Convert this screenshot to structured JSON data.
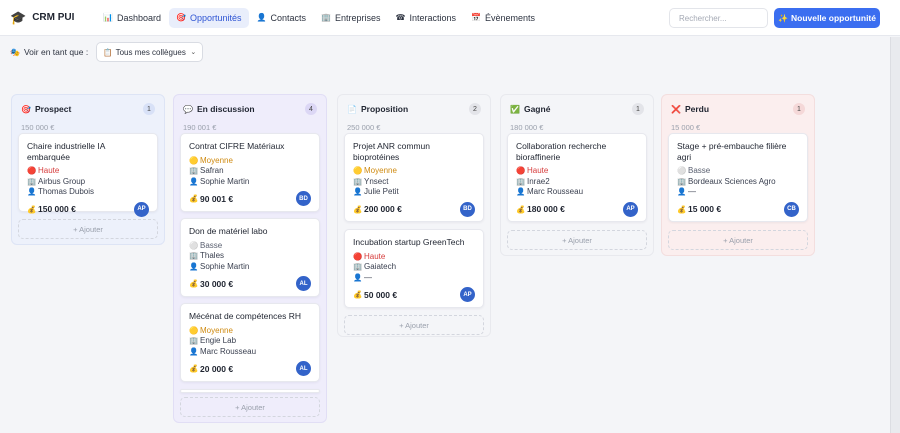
{
  "header": {
    "brand_icon": "🎓",
    "brand_name": "CRM PUI",
    "nav": [
      {
        "icon": "📊",
        "label": "Dashboard",
        "active": false
      },
      {
        "icon": "🎯",
        "label": "Opportunités",
        "active": true
      },
      {
        "icon": "👤",
        "label": "Contacts",
        "active": false
      },
      {
        "icon": "🏢",
        "label": "Entreprises",
        "active": false
      },
      {
        "icon": "☎",
        "label": "Interactions",
        "active": false
      },
      {
        "icon": "📅",
        "label": "Évènements",
        "active": false
      }
    ],
    "search_placeholder": "Rechercher...",
    "new_button_icon": "✨",
    "new_button_label": "Nouvelle opportunité"
  },
  "filter": {
    "icon": "🎭",
    "label": "Voir en tant que :",
    "select_icon": "📋",
    "select_value": "Tous mes collègues",
    "chevron": "⌄"
  },
  "add_label": "+ Ajouter",
  "colors": {
    "accent": "#3b6ef0",
    "haute": "#d63b3b",
    "moyenne": "#cf8a10"
  },
  "columns": [
    {
      "icon": "🎯",
      "title": "Prospect",
      "count": "1",
      "total": "150 000 €",
      "cards": [
        {
          "title": "Chaire industrielle IA embarquée",
          "prio_icon": "🔴",
          "prio": "Haute",
          "prio_class": "haute",
          "company": "Airbus Group",
          "contact": "Thomas Dubois",
          "amount": "150 000 €",
          "avatar": "AP"
        }
      ]
    },
    {
      "icon": "💬",
      "title": "En discussion",
      "count": "4",
      "total": "190 001 €",
      "cards": [
        {
          "title": "Contrat CIFRE Matériaux",
          "prio_icon": "🟡",
          "prio": "Moyenne",
          "prio_class": "moyenne",
          "company": "Safran",
          "contact": "Sophie Martin",
          "amount": "90 001 €",
          "avatar": "BD"
        },
        {
          "title": "Don de matériel labo",
          "prio_icon": "⚪",
          "prio": "Basse",
          "prio_class": "basse",
          "company": "Thales",
          "contact": "Sophie Martin",
          "amount": "30 000 €",
          "avatar": "AL"
        },
        {
          "title": "Mécénat de compétences RH",
          "prio_icon": "🟡",
          "prio": "Moyenne",
          "prio_class": "moyenne",
          "company": "Engie Lab",
          "contact": "Marc Rousseau",
          "amount": "20 000 €",
          "avatar": "AL"
        }
      ]
    },
    {
      "icon": "📄",
      "title": "Proposition",
      "count": "2",
      "total": "250 000 €",
      "cards": [
        {
          "title": "Projet ANR commun bioprotéines",
          "prio_icon": "🟡",
          "prio": "Moyenne",
          "prio_class": "moyenne",
          "company": "Ynsect",
          "contact": "Julie Petit",
          "amount": "200 000 €",
          "avatar": "BD"
        },
        {
          "title": "Incubation startup GreenTech",
          "prio_icon": "🔴",
          "prio": "Haute",
          "prio_class": "haute",
          "company": "Gaiatech",
          "contact": "—",
          "amount": "50 000 €",
          "avatar": "AP"
        }
      ]
    },
    {
      "icon": "✅",
      "title": "Gagné",
      "count": "1",
      "total": "180 000 €",
      "cards": [
        {
          "title": "Collaboration recherche bioraffinerie",
          "prio_icon": "🔴",
          "prio": "Haute",
          "prio_class": "haute",
          "company": "Inrae2",
          "contact": "Marc Rousseau",
          "amount": "180 000 €",
          "avatar": "AP"
        }
      ]
    },
    {
      "icon": "❌",
      "title": "Perdu",
      "count": "1",
      "total": "15 000 €",
      "cards": [
        {
          "title": "Stage + pré-embauche filière agri",
          "prio_icon": "⚪",
          "prio": "Basse",
          "prio_class": "basse",
          "company": "Bordeaux Sciences Agro",
          "contact": "—",
          "amount": "15 000 €",
          "avatar": "CB"
        }
      ]
    }
  ]
}
